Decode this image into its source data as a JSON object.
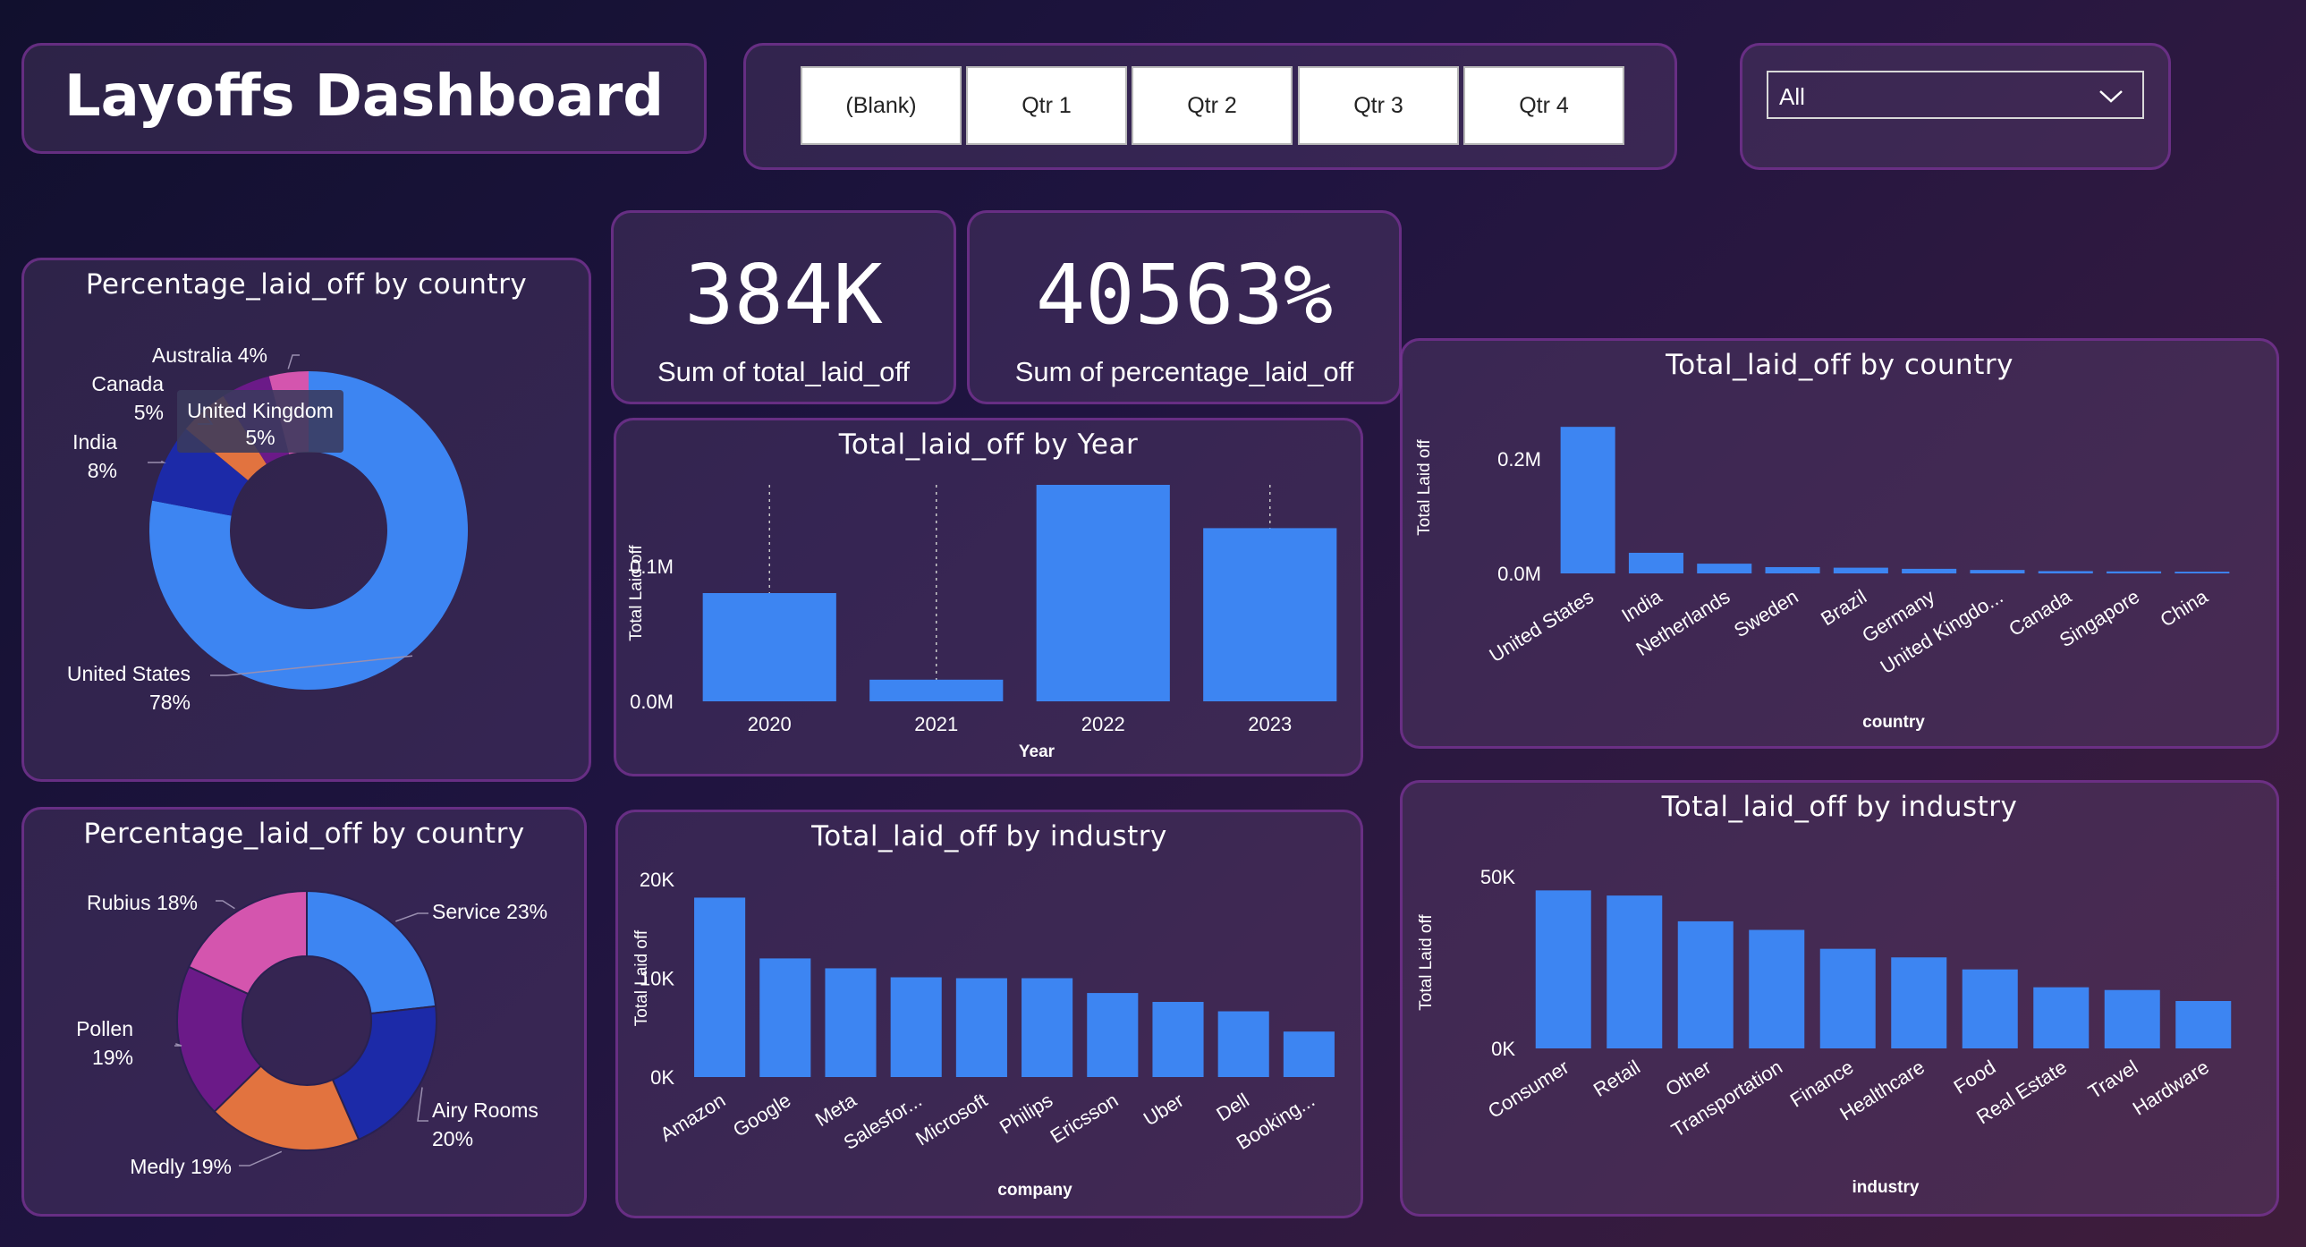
{
  "header": {
    "title": "Layoffs Dashboard"
  },
  "quarter_slicer": {
    "buttons": [
      "(Blank)",
      "Qtr 1",
      "Qtr 2",
      "Qtr 3",
      "Qtr 4"
    ]
  },
  "dropdown": {
    "selected": "All"
  },
  "kpis": {
    "total_value": "384K",
    "total_label": "Sum of total_laid_off",
    "pct_value": "40563%",
    "pct_label": "Sum of percentage_laid_off"
  },
  "colors": {
    "bar": "#3d85f2",
    "panel_border": "#7a3296"
  },
  "chart_data": [
    {
      "id": "donut-country",
      "type": "pie",
      "title": "Percentage_laid_off by country",
      "slices": [
        {
          "label": "United States",
          "value": 78,
          "pct_label": "78%",
          "color": "#3d85f2"
        },
        {
          "label": "India",
          "value": 8,
          "pct_label": "8%",
          "color": "#1c2aa8"
        },
        {
          "label": "Canada",
          "value": 5,
          "pct_label": "5%",
          "color": "#e2733f"
        },
        {
          "label": "United Kingdom",
          "value": 5,
          "pct_label": "5%",
          "color": "#6b1a88"
        },
        {
          "label": "Australia",
          "value": 4,
          "pct_label": "4%",
          "color": "#d455ae"
        }
      ],
      "tooltip": {
        "line1": "United Kingdom",
        "line2": "5%"
      }
    },
    {
      "id": "donut-company",
      "type": "pie",
      "title": "Percentage_laid_off by country",
      "slices": [
        {
          "label": "Service",
          "value": 23,
          "pct_label": "23%",
          "color": "#3d85f2"
        },
        {
          "label": "Airy Rooms",
          "value": 20,
          "pct_label": "20%",
          "color": "#1c2aa8"
        },
        {
          "label": "Medly",
          "value": 19,
          "pct_label": "19%",
          "color": "#e2733f"
        },
        {
          "label": "Pollen",
          "value": 19,
          "pct_label": "19%",
          "color": "#6b1a88"
        },
        {
          "label": "Rubius",
          "value": 18,
          "pct_label": "18%",
          "color": "#d455ae"
        }
      ]
    },
    {
      "id": "bar-year",
      "type": "bar",
      "title": "Total_laid_off by Year",
      "xlabel": "Year",
      "ylabel": "Total Laid off",
      "categories": [
        "2020",
        "2021",
        "2022",
        "2023"
      ],
      "values": [
        80000,
        16000,
        160000,
        128000
      ],
      "ylim": [
        0,
        160000
      ],
      "ticks": [
        {
          "v": 0,
          "label": "0.0M"
        },
        {
          "v": 100000,
          "label": "0.1M"
        }
      ]
    },
    {
      "id": "bar-company",
      "type": "bar",
      "title": "Total_laid_off by industry",
      "xlabel": "company",
      "ylabel": "Total Laid off",
      "categories": [
        "Amazon",
        "Google",
        "Meta",
        "Salesfor...",
        "Microsoft",
        "Philips",
        "Ericsson",
        "Uber",
        "Dell",
        "Booking..."
      ],
      "values": [
        18150,
        12000,
        11000,
        10090,
        10000,
        10000,
        8500,
        7600,
        6650,
        4600
      ],
      "ylim": [
        0,
        20000
      ],
      "ticks": [
        {
          "v": 0,
          "label": "0K"
        },
        {
          "v": 10000,
          "label": "10K"
        },
        {
          "v": 20000,
          "label": "20K"
        }
      ]
    },
    {
      "id": "bar-country",
      "type": "bar",
      "title": "Total_laid_off by country",
      "xlabel": "country",
      "ylabel": "Total Laid off",
      "categories": [
        "United States",
        "India",
        "Netherlands",
        "Sweden",
        "Brazil",
        "Germany",
        "United Kingdo...",
        "Canada",
        "Singapore",
        "China"
      ],
      "values": [
        256000,
        36000,
        17000,
        11000,
        10000,
        8000,
        6000,
        4000,
        3500,
        3000
      ],
      "ylim": [
        0,
        300000
      ],
      "ticks": [
        {
          "v": 0,
          "label": "0.0M"
        },
        {
          "v": 200000,
          "label": "0.2M"
        }
      ]
    },
    {
      "id": "bar-industry",
      "type": "bar",
      "title": "Total_laid_off by industry",
      "xlabel": "industry",
      "ylabel": "Total Laid off",
      "categories": [
        "Consumer",
        "Retail",
        "Other",
        "Transportation",
        "Finance",
        "Healthcare",
        "Food",
        "Real Estate",
        "Travel",
        "Hardware"
      ],
      "values": [
        46000,
        44500,
        37000,
        34500,
        29000,
        26500,
        23000,
        17800,
        17000,
        13800
      ],
      "ylim": [
        0,
        50000
      ],
      "ticks": [
        {
          "v": 0,
          "label": "0K"
        },
        {
          "v": 50000,
          "label": "50K"
        }
      ]
    }
  ]
}
